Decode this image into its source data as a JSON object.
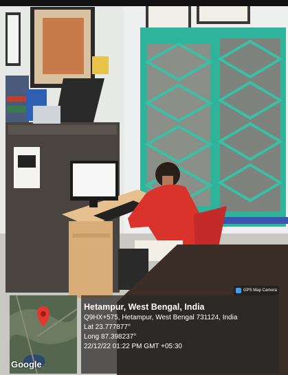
{
  "badge": {
    "label": "GPS Map Camera"
  },
  "location": {
    "title": "Hetampur, West Bengal, India",
    "address": "Q9HX+575, Hetampur, West Bengal 731124, India",
    "lat": "Lat 23.777877°",
    "long": "Long 87.398237°",
    "datetime": "22/12/22 01:22 PM GMT +05:30"
  },
  "map": {
    "provider": "Google",
    "marker": "map-pin-icon"
  },
  "colors": {
    "window_frame": "#2fb39a",
    "hoodie": "#d9332b",
    "desk": "#e7c08f",
    "wall": "#f3f4f3",
    "overlay": "#282828"
  }
}
